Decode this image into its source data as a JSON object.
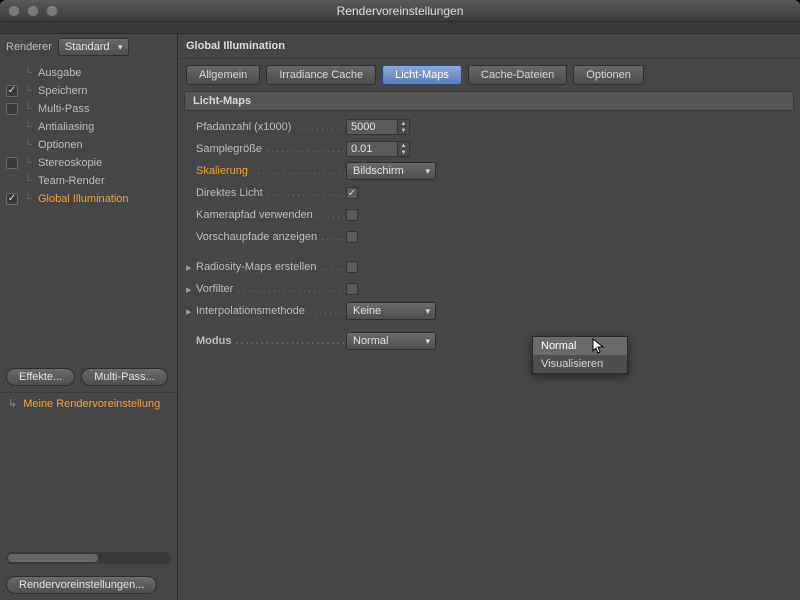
{
  "window": {
    "title": "Rendervoreinstellungen"
  },
  "sidebar": {
    "renderer_label": "Renderer",
    "renderer_value": "Standard",
    "items": [
      {
        "label": "Ausgabe",
        "checked": null
      },
      {
        "label": "Speichern",
        "checked": true
      },
      {
        "label": "Multi-Pass",
        "checked": false
      },
      {
        "label": "Antialiasing",
        "checked": null
      },
      {
        "label": "Optionen",
        "checked": null
      },
      {
        "label": "Stereoskopie",
        "checked": false
      },
      {
        "label": "Team-Render",
        "checked": null
      },
      {
        "label": "Global Illumination",
        "checked": true,
        "highlight": true
      }
    ],
    "effects_btn": "Effekte...",
    "multipass_btn": "Multi-Pass...",
    "preset": "Meine Rendervoreinstellung",
    "footer_btn": "Rendervoreinstellungen..."
  },
  "panel": {
    "title": "Global Illumination",
    "tabs": [
      "Allgemein",
      "Irradiance Cache",
      "Licht-Maps",
      "Cache-Dateien",
      "Optionen"
    ],
    "active_tab": "Licht-Maps",
    "section": "Licht-Maps",
    "fields": {
      "pfadanzahl_label": "Pfadanzahl (x1000)",
      "pfadanzahl_value": "5000",
      "samplegroesse_label": "Samplegröße",
      "samplegroesse_value": "0.01",
      "skalierung_label": "Skalierung",
      "skalierung_value": "Bildschirm",
      "direktes_licht_label": "Direktes Licht",
      "kamerapfad_label": "Kamerapfad verwenden",
      "vorschaupfade_label": "Vorschaupfade anzeigen",
      "radiosity_label": "Radiosity-Maps erstellen",
      "vorfilter_label": "Vorfilter",
      "interpolation_label": "Interpolationsmethode",
      "interpolation_value": "Keine",
      "modus_label": "Modus",
      "modus_value": "Normal",
      "modus_options": [
        "Normal",
        "Visualisieren"
      ]
    }
  }
}
